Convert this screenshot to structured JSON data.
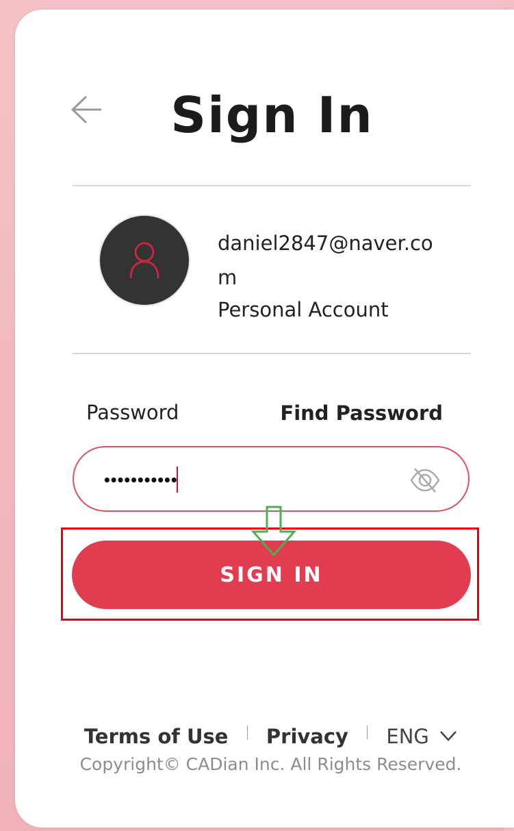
{
  "header": {
    "title": "Sign In",
    "back_icon": "arrow-left-icon"
  },
  "account": {
    "email": "daniel2847@naver.com",
    "type": "Personal Account",
    "avatar_icon": "user-icon"
  },
  "password": {
    "label": "Password",
    "find_label": "Find Password",
    "masked_value": "•••••••••••",
    "toggle_icon": "eye-slash-icon"
  },
  "actions": {
    "sign_in_label": "SIGN IN"
  },
  "footer": {
    "terms_label": "Terms of Use",
    "privacy_label": "Privacy",
    "language_label": "ENG",
    "language_icon": "chevron-down-icon",
    "copyright": "Copyright© CADian Inc. All Rights Reserved."
  },
  "colors": {
    "accent": "#e23c50",
    "highlight_outline": "#e60012",
    "annotation_arrow": "#4caf50",
    "avatar_bg": "#333333",
    "avatar_icon": "#c5283d"
  }
}
